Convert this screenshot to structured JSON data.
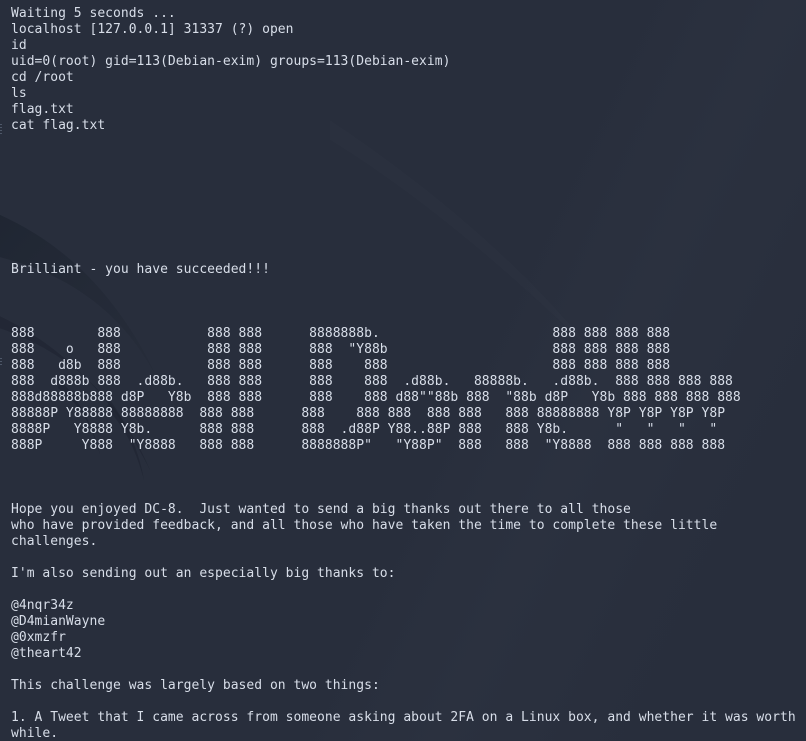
{
  "terminal": {
    "background_color": "#282e3c",
    "foreground_color": "#d8dee9",
    "wallpaper_color": "#232834",
    "lines": [
      "Waiting 5 seconds ...",
      "localhost [127.0.0.1] 31337 (?) open",
      "id",
      "uid=0(root) gid=113(Debian-exim) groups=113(Debian-exim)",
      "cd /root",
      "ls",
      "flag.txt",
      "cat flag.txt",
      "",
      "",
      "",
      "",
      "",
      "",
      "",
      "",
      "Brilliant - you have succeeded!!!",
      "",
      "",
      "",
      "888        888           888 888      8888888b.                      888 888 888 888",
      "888    o   888           888 888      888  \"Y88b                     888 888 888 888",
      "888   d8b  888           888 888      888    888                     888 888 888 888",
      "888  d888b 888  .d88b.   888 888      888    888  .d88b.   88888b.   .d88b.  888 888 888 888",
      "888d88888b888 d8P   Y8b  888 888      888    888 d88\"\"88b 888  \"88b d8P   Y8b 888 888 888 888",
      "88888P Y88888 88888888  888 888      888    888 888  888 888   888 88888888 Y8P Y8P Y8P Y8P",
      "8888P   Y8888 Y8b.      888 888      888  .d88P Y88..88P 888   888 Y8b.      \"   \"   \"   \" ",
      "888P     Y888  \"Y8888   888 888      8888888P\"   \"Y88P\"  888   888  \"Y8888  888 888 888 888",
      "",
      "",
      "",
      "Hope you enjoyed DC-8.  Just wanted to send a big thanks out there to all those",
      "who have provided feedback, and all those who have taken the time to complete these little",
      "challenges.",
      "",
      "I'm also sending out an especially big thanks to:",
      "",
      "@4nqr34z",
      "@D4mianWayne",
      "@0xmzfr",
      "@theart42",
      "",
      "This challenge was largely based on two things:",
      "",
      "1. A Tweet that I came across from someone asking about 2FA on a Linux box, and whether it was worth",
      "while."
    ]
  }
}
